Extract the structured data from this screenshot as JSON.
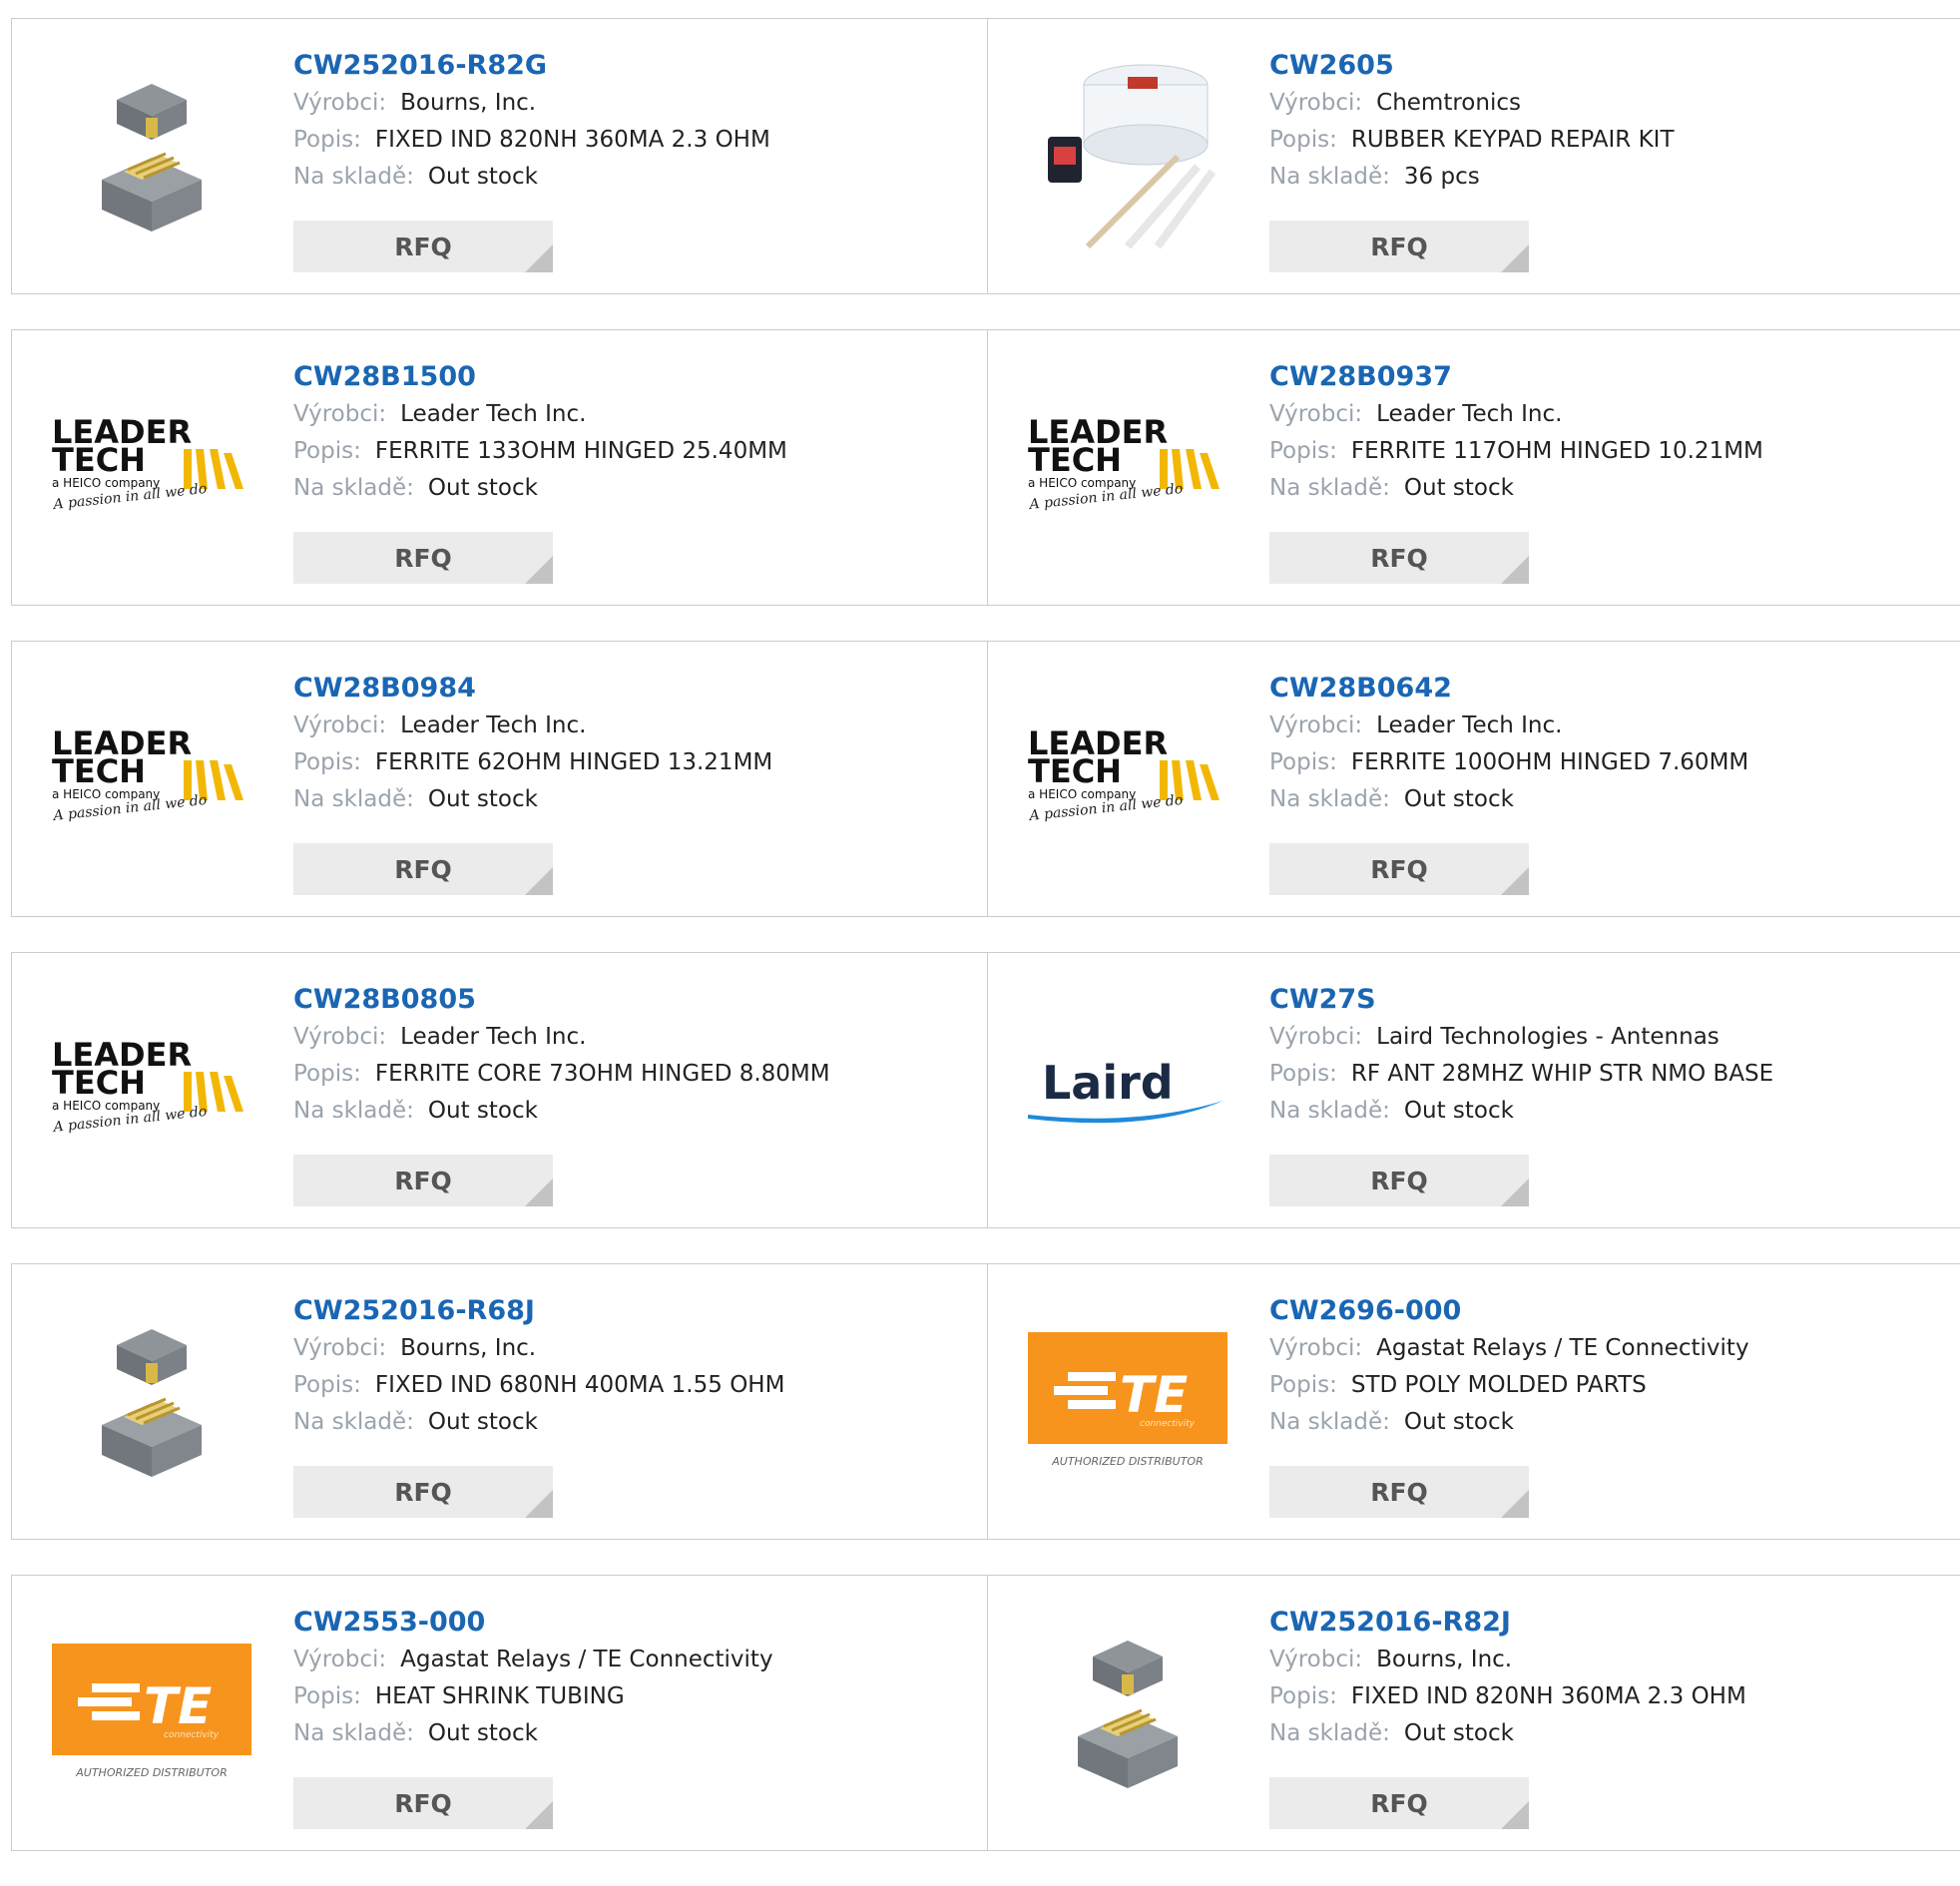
{
  "labels": {
    "manufacturer": "Výrobci:",
    "description": "Popis:",
    "stock": "Na skladě:",
    "rfq": "RFQ"
  },
  "products": [
    {
      "pn": "CW252016-R82G",
      "manufacturer": "Bourns, Inc.",
      "description": "FIXED IND 820NH 360MA 2.3 OHM",
      "stock": "Out stock",
      "image": "inductor"
    },
    {
      "pn": "CW2605",
      "manufacturer": "Chemtronics",
      "description": "RUBBER KEYPAD REPAIR KIT",
      "stock": "36 pcs",
      "image": "kit"
    },
    {
      "pn": "CW28B1500",
      "manufacturer": "Leader Tech Inc.",
      "description": "FERRITE 133OHM HINGED 25.40MM",
      "stock": "Out stock",
      "image": "leadertech"
    },
    {
      "pn": "CW28B0937",
      "manufacturer": "Leader Tech Inc.",
      "description": "FERRITE 117OHM HINGED 10.21MM",
      "stock": "Out stock",
      "image": "leadertech"
    },
    {
      "pn": "CW28B0984",
      "manufacturer": "Leader Tech Inc.",
      "description": "FERRITE 62OHM HINGED 13.21MM",
      "stock": "Out stock",
      "image": "leadertech"
    },
    {
      "pn": "CW28B0642",
      "manufacturer": "Leader Tech Inc.",
      "description": "FERRITE 100OHM HINGED 7.60MM",
      "stock": "Out stock",
      "image": "leadertech"
    },
    {
      "pn": "CW28B0805",
      "manufacturer": "Leader Tech Inc.",
      "description": "FERRITE CORE 73OHM HINGED 8.80MM",
      "stock": "Out stock",
      "image": "leadertech"
    },
    {
      "pn": "CW27S",
      "manufacturer": "Laird Technologies - Antennas",
      "description": "RF ANT 28MHZ WHIP STR NMO BASE",
      "stock": "Out stock",
      "image": "laird"
    },
    {
      "pn": "CW252016-R68J",
      "manufacturer": "Bourns, Inc.",
      "description": "FIXED IND 680NH 400MA 1.55 OHM",
      "stock": "Out stock",
      "image": "inductor"
    },
    {
      "pn": "CW2696-000",
      "manufacturer": "Agastat Relays / TE Connectivity",
      "description": "STD POLY MOLDED PARTS",
      "stock": "Out stock",
      "image": "te"
    },
    {
      "pn": "CW2553-000",
      "manufacturer": "Agastat Relays / TE Connectivity",
      "description": "HEAT SHRINK TUBING",
      "stock": "Out stock",
      "image": "te"
    },
    {
      "pn": "CW252016-R82J",
      "manufacturer": "Bourns, Inc.",
      "description": "FIXED IND 820NH 360MA 2.3 OHM",
      "stock": "Out stock",
      "image": "inductor"
    }
  ],
  "logos": {
    "leadertech": {
      "line1": "LEADER",
      "line2": "TECH",
      "sub": "a HEICO company",
      "tagline": "A passion in all we do"
    },
    "laird": {
      "text": "Laird"
    },
    "te": {
      "text": "TE",
      "sub": "connectivity",
      "caption": "AUTHORIZED DISTRIBUTOR"
    }
  },
  "colors": {
    "link": "#1a66b3",
    "label": "#9aa3ad",
    "te_orange": "#f7941d",
    "leader_yellow": "#f2b705",
    "laird_blue": "#1f8ad9"
  }
}
